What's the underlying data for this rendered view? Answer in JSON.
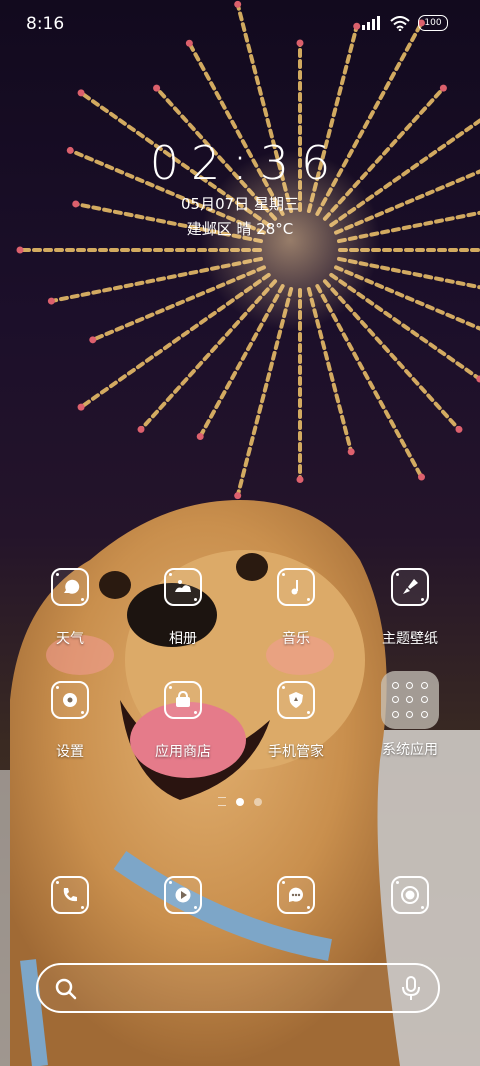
{
  "status_bar": {
    "time": "8:16",
    "battery": "100",
    "icons": [
      "signal-icon",
      "wifi-icon",
      "battery-icon"
    ]
  },
  "clock_widget": {
    "time": "02:36",
    "date": "05月07日 星期三",
    "weather": "建邺区 晴 28°C"
  },
  "apps": [
    {
      "label": "天气",
      "icon": "weather-icon"
    },
    {
      "label": "相册",
      "icon": "gallery-icon"
    },
    {
      "label": "音乐",
      "icon": "music-icon"
    },
    {
      "label": "主题壁纸",
      "icon": "theme-brush-icon"
    },
    {
      "label": "设置",
      "icon": "settings-gear-icon"
    },
    {
      "label": "应用商店",
      "icon": "app-store-bag-icon"
    },
    {
      "label": "手机管家",
      "icon": "security-shield-icon"
    },
    {
      "label": "系统应用",
      "icon": "folder-grid-icon"
    }
  ],
  "page_indicator": {
    "pages": 2,
    "active": 1
  },
  "dock": [
    {
      "icon": "phone-icon"
    },
    {
      "icon": "browser-icon"
    },
    {
      "icon": "messages-icon"
    },
    {
      "icon": "camera-icon"
    }
  ],
  "search_bar": {
    "icons": [
      "search-icon",
      "mic-icon"
    ]
  },
  "colors": {
    "text": "#ffffff",
    "firework": "#f3c66b",
    "sky": "#120a1e"
  }
}
